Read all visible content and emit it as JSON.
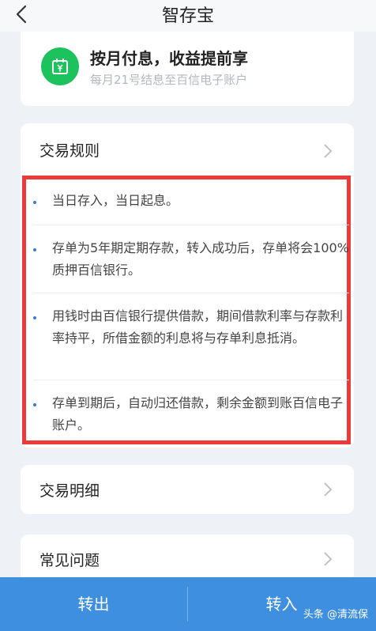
{
  "header": {
    "title": "智存宝"
  },
  "banner": {
    "title": "按月付息，收益提前享",
    "subtitle": "每月21号结息至百信电子账户",
    "icon_color": "#1cc25b"
  },
  "rules": {
    "title": "交易规则",
    "items": [
      "当日存入，当日起息。",
      "存单为5年期定期存款，转入成功后，存单将会100%质押百信银行。",
      "用钱时由百信银行提供借款，期间借款利率与存款利率持平，所借金额的利息将与存单利息抵消。",
      "存单到期后，自动归还借款，剩余金额到账百信电子账户。"
    ],
    "highlight_color": "#ea3a3a"
  },
  "details": {
    "title": "交易明细"
  },
  "faq": {
    "title": "常见问题"
  },
  "bottom_bar": {
    "transfer_out": "转出",
    "transfer_in": "转入",
    "watermark": "头条 @清流保",
    "color": "#3f8fe0"
  }
}
